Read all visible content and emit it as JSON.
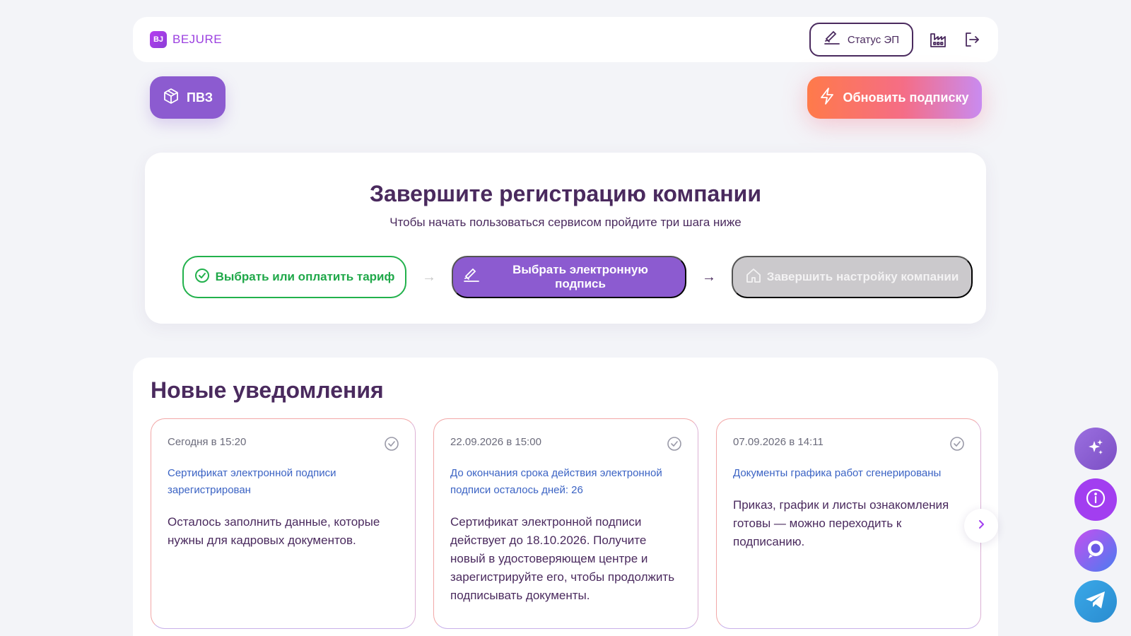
{
  "header": {
    "logo_mark": "BJ",
    "logo_text": "BEJURE",
    "status_label": "Статус ЭП",
    "icons": [
      "factory-icon",
      "logout-icon"
    ]
  },
  "pvz": {
    "label": "ПВЗ",
    "icon": "box-icon"
  },
  "upgrade": {
    "label": "Обновить подписку",
    "icon": "lightning-icon"
  },
  "registration": {
    "title": "Завершите регистрацию компании",
    "subtitle": "Чтобы начать пользоваться сервисом пройдите три шага ниже",
    "steps": [
      {
        "label": "Выбрать или оплатить тариф",
        "state": "done",
        "icon": "check-circle-icon"
      },
      {
        "label": "Выбрать электронную подпись",
        "state": "active",
        "icon": "signature-icon"
      },
      {
        "label": "Завершить настройку компании",
        "state": "locked",
        "icon": "home-icon"
      }
    ]
  },
  "notifications": {
    "title": "Новые уведомления",
    "items": [
      {
        "date": "Сегодня в 15:20",
        "link": "Сертификат электронной подписи зарегистрирован",
        "text": "Осталось заполнить данные, которые нужны для кадровых документов."
      },
      {
        "date": "22.09.2026 в 15:00",
        "link": "До окончания срока действия электронной подписи осталось дней: 26",
        "text": "Сертификат электронной подписи действует до 18.10.2026. Получите новый в удостоверяющем центре и зарегистрируйте его, чтобы продолжить подписывать документы."
      },
      {
        "date": "07.09.2026 в 14:11",
        "link": "Документы графика работ сгенерированы",
        "text": "Приказ, график и листы ознакомления готовы — можно переходить к подписанию."
      }
    ]
  },
  "colors": {
    "primary": "#8c5bd0",
    "success": "#22b14c",
    "text": "#4a2a5e",
    "link": "#3b63c4",
    "accent_orange": "#ff7a4a"
  }
}
